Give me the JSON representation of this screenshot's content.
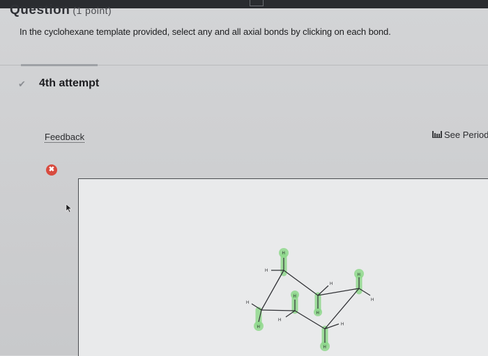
{
  "question": {
    "title": "Question",
    "points": "(1 point)"
  },
  "instruction": "In the cyclohexane template provided, select any and all axial bonds by clicking on each bond.",
  "attempt": {
    "label": "4th attempt"
  },
  "feedback_link": "Feedback",
  "periodic_link": "See Periodi",
  "status": {
    "icon": "x-icon",
    "color": "#d84b3f"
  },
  "molecule": {
    "atom_label": "H"
  },
  "colors": {
    "highlight": "#8fd88c",
    "bond": "#2f3034",
    "accent_error": "#d84b3f"
  }
}
